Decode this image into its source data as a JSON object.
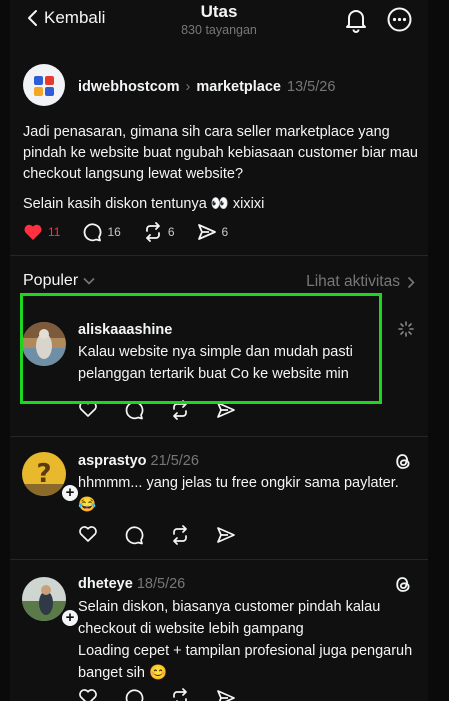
{
  "header": {
    "back_label": "Kembali",
    "title": "Utas",
    "views": "830 tayangan"
  },
  "post": {
    "author": "idwebhostcom",
    "separator": "›",
    "community": "marketplace",
    "date": "13/5/26",
    "paragraphs": [
      "Jadi penasaran, gimana sih cara seller marketplace yang pindah ke website buat ngubah kebiasaan customer biar mau checkout langsung lewat website?",
      "Selain kasih diskon tentunya 👀 xixixi"
    ],
    "likes": "11",
    "comments": "16",
    "reposts": "6",
    "shares": "6"
  },
  "sort": {
    "label": "Populer",
    "activity_label": "Lihat aktivitas"
  },
  "replies": [
    {
      "username": "aliskaaashine",
      "date": "",
      "lines": [
        "Kalau website nya simple dan mudah pasti pelanggan tertarik buat Co ke website min"
      ]
    },
    {
      "username": "asprastyo",
      "date": "21/5/26",
      "lines": [
        "hhmmm... yang jelas tu free ongkir sama paylater.",
        "😂"
      ]
    },
    {
      "username": "dheteye",
      "date": "18/5/26",
      "lines": [
        "Selain diskon, biasanya customer pindah kalau checkout di website lebih gampang",
        "Loading cepet + tampilan profesional juga pengaruh banget sih 😊"
      ]
    }
  ],
  "colors": {
    "accent_like": "#ff3040",
    "highlight": "#1ed61e",
    "background": "#101010"
  }
}
